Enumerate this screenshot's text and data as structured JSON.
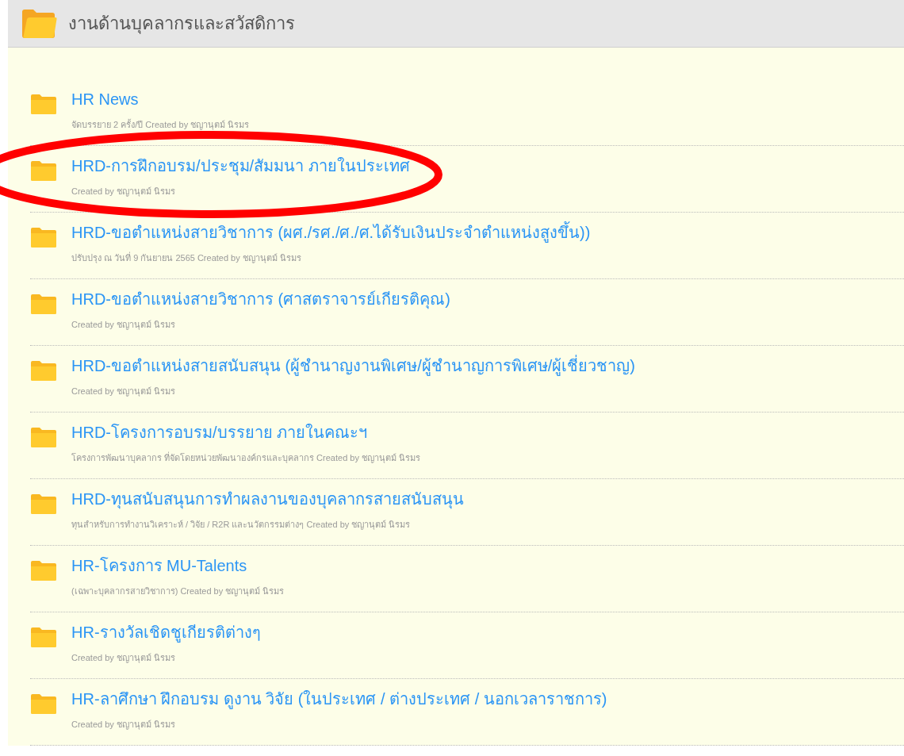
{
  "header": {
    "title": "งานด้านบุคลากรและสวัสดิการ"
  },
  "folders": [
    {
      "title": "HR News",
      "description": "จัดบรรยาย 2 ครั้ง/ปี Created by ชญานุตม์ นิรมร"
    },
    {
      "title": "HRD-การฝึกอบรม/ประชุม/สัมมนา ภายในประเทศ",
      "description": "Created by ชญานุตม์ นิรมร"
    },
    {
      "title": "HRD-ขอตำแหน่งสายวิชาการ (ผศ./รศ./ศ./ศ.ได้รับเงินประจำตำแหน่งสูงขึ้น))",
      "description": "ปรับปรุง ณ วันที่ 9 กันยายน 2565 Created by ชญานุตม์ นิรมร"
    },
    {
      "title": "HRD-ขอตำแหน่งสายวิชาการ (ศาสตราจารย์เกียรติคุณ)",
      "description": "Created by ชญานุตม์ นิรมร"
    },
    {
      "title": "HRD-ขอตำแหน่งสายสนับสนุน (ผู้ชำนาญงานพิเศษ/ผู้ชำนาญการพิเศษ/ผู้เชี่ยวชาญ)",
      "description": "Created by ชญานุตม์ นิรมร"
    },
    {
      "title": "HRD-โครงการอบรม/บรรยาย ภายในคณะฯ",
      "description": "โครงการพัฒนาบุคลากร ที่จัดโดยหน่วยพัฒนาองค์กรและบุคลากร Created by ชญานุตม์ นิรมร"
    },
    {
      "title": "HRD-ทุนสนับสนุนการทำผลงานของบุคลากรสายสนับสนุน",
      "description": "ทุนสำหรับการทำงานวิเคราะห์ / วิจัย / R2R และนวัตกรรมต่างๆ Created by ชญานุตม์ นิรมร"
    },
    {
      "title": "HR-โครงการ MU-Talents",
      "description": "(เฉพาะบุคลากรสายวิชาการ) Created by ชญานุตม์ นิรมร"
    },
    {
      "title": "HR-รางวัลเชิดชูเกียรติต่างๆ",
      "description": "Created by ชญานุตม์ นิรมร"
    },
    {
      "title": "HR-ลาศึกษา ฝึกอบรม ดูงาน วิจัย (ในประเทศ / ต่างประเทศ / นอกเวลาราชการ)",
      "description": "Created by ชญานุตม์ นิรมร"
    }
  ],
  "annotation": {
    "kind": "ellipse"
  }
}
